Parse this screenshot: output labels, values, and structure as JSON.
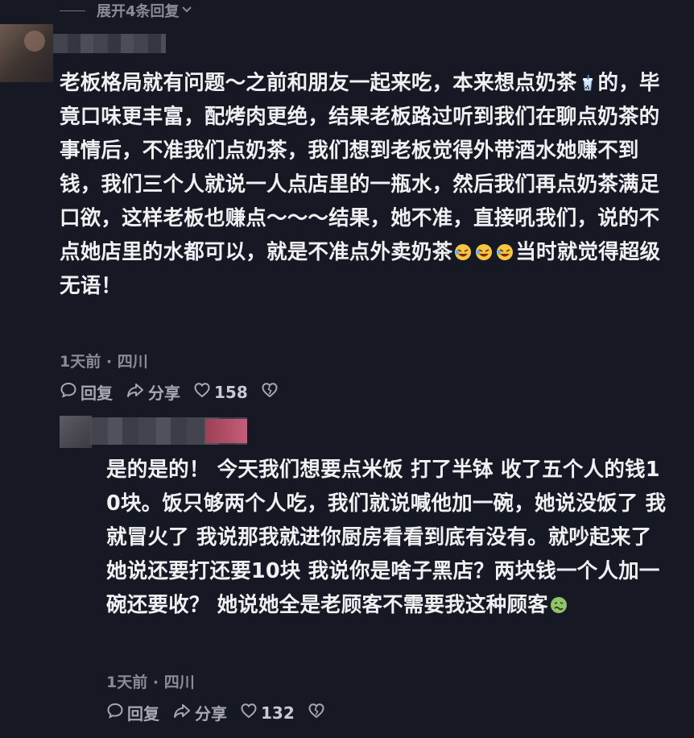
{
  "thread": {
    "expand_replies_label": "展开4条回复"
  },
  "comments": [
    {
      "text_part1": "老板格局就有问题～之前和朋友一起来吃，本来想点奶茶",
      "text_part2": "的，毕竟口味更丰富，配烤肉更绝，结果老板路过听到我们在聊点奶茶的事情后，不准我们点奶茶，我们想到老板觉得外带酒水她赚不到钱，我们三个人就说一人点店里的一瓶水，然后我们再点奶茶满足口欲，这样老板也赚点～～～结果，她不准，直接吼我们，说的不点她店里的水都可以，就是不准点外卖奶茶",
      "text_part3": "当时就觉得超级无语！",
      "time": "1天前",
      "location": "四川",
      "reply_label": "回复",
      "share_label": "分享",
      "likes": "158"
    },
    {
      "text_part1": "是的是的！ 今天我们想要点米饭 打了半钵 收了五个人的钱10块。饭只够两个人吃，我们就说喊他加一碗，她说没饭了 我就冒火了 我说那我就进你厨房看看到底有没有。就吵起来了 她说还要打还要10块 我说你是啥子黑店？两块钱一个人加一碗还要收？ 她说她全是老顾客不需要我这种顾客",
      "time": "1天前",
      "location": "四川",
      "reply_label": "回复",
      "share_label": "分享",
      "likes": "132"
    }
  ],
  "separator": " · ",
  "icons": {
    "chevron": "chevron-down-icon",
    "reply": "comment-bubble-icon",
    "share": "share-arrow-icon",
    "like": "heart-icon",
    "dislike": "broken-heart-icon",
    "milk_tea": "bubble-tea-emoji",
    "laugh_cry": "rolling-laughing-emoji",
    "sick": "nauseated-face-emoji"
  },
  "colors": {
    "background": "#161823",
    "text": "#f0f0f3",
    "muted": "#8a8b93"
  }
}
